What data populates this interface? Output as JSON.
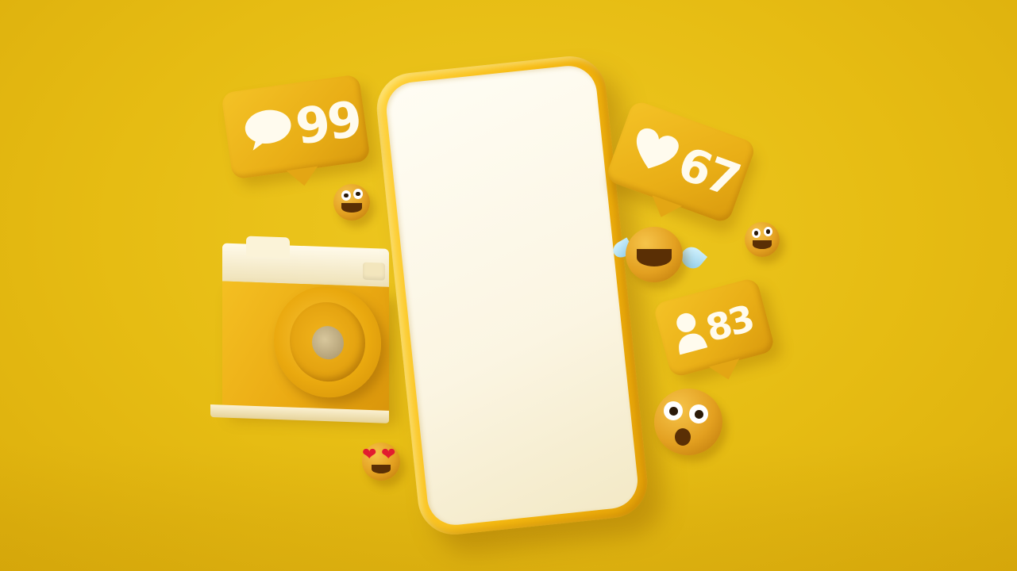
{
  "scene": {
    "background_color": "#e8bf18",
    "phone_accent": "#f6bb12",
    "screen_color": "#fcf7e6"
  },
  "notifications": {
    "comments": {
      "icon": "speech-bubble-icon",
      "count": "99"
    },
    "likes": {
      "icon": "heart-icon",
      "count": "67"
    },
    "followers": {
      "icon": "user-icon",
      "count": "83"
    }
  },
  "emojis": [
    "grinning-emoji",
    "grinning-emoji-small",
    "tears-of-joy-emoji",
    "heart-eyes-emoji",
    "surprised-emoji"
  ],
  "objects": [
    "smartphone",
    "camera"
  ]
}
